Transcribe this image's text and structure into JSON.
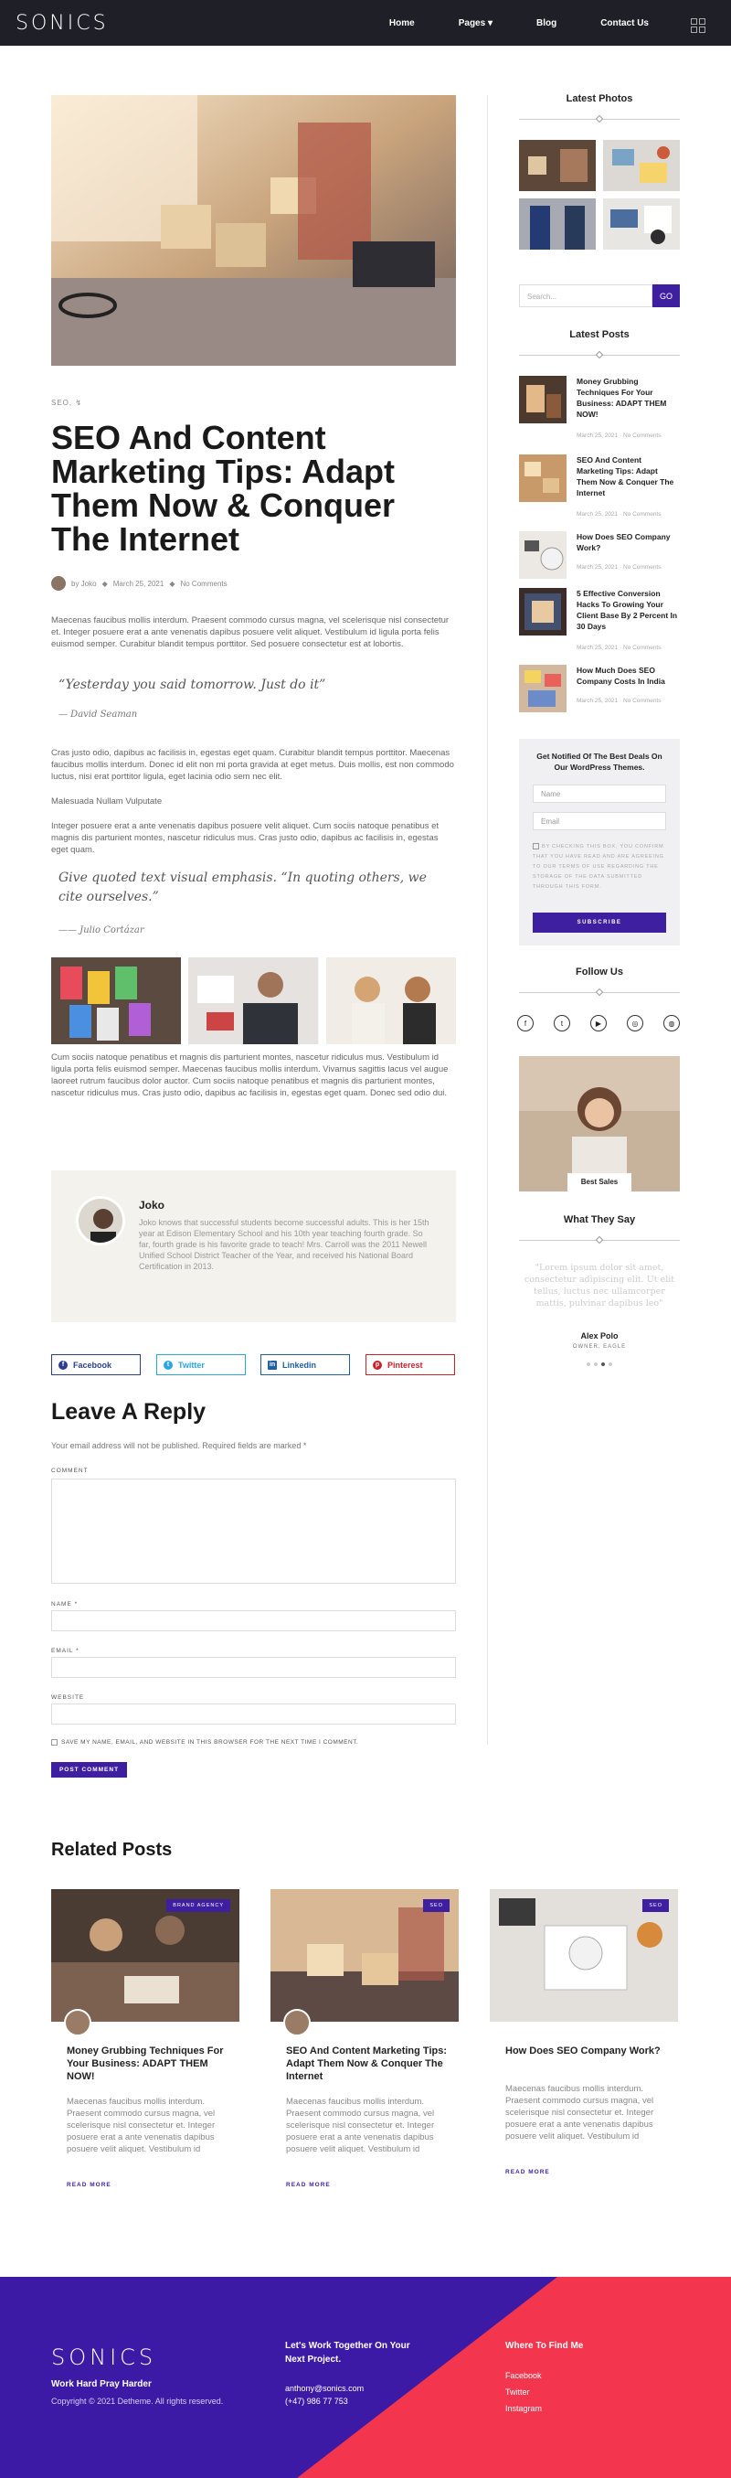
{
  "header": {
    "logo": "SONICS",
    "nav": [
      "Home",
      "Pages ▾",
      "Blog",
      "Contact Us"
    ]
  },
  "post": {
    "category": "SEO, ↯",
    "title": "SEO And Content Marketing Tips: Adapt Them Now & Conquer The Internet",
    "meta_author": "by Joko",
    "meta_date": "March 25, 2021",
    "meta_comments": "No Comments",
    "para1": "Maecenas faucibus mollis interdum. Praesent commodo cursus magna, vel scelerisque nisl consectetur et. Integer posuere erat a ante venenatis dapibus posuere velit aliquet. Vestibulum id ligula porta felis euismod semper. Curabitur blandit tempus porttitor. Sed posuere consectetur est at lobortis.",
    "quote1": "“Yesterday you said tomorrow. Just do it”",
    "cite1": "— David Seaman",
    "para2": "Cras justo odio, dapibus ac facilisis in, egestas eget quam. Curabitur blandit tempus porttitor. Maecenas faucibus mollis interdum. Donec id elit non mi porta gravida at eget metus. Duis mollis, est non commodo luctus, nisi erat porttitor ligula, eget lacinia odio sem nec elit.",
    "para3": "Malesuada Nullam Vulputate",
    "para4": "Integer posuere erat a ante venenatis dapibus posuere velit aliquet. Cum sociis natoque penatibus et magnis dis parturient montes, nascetur ridiculus mus. Cras justo odio, dapibus ac facilisis in, egestas eget quam.",
    "quote2": "Give quoted text visual emphasis. “In quoting others, we cite ourselves.”",
    "cite2": "—— Julio Cortázar",
    "para5": "Cum sociis natoque penatibus et magnis dis parturient montes, nascetur ridiculus mus. Vestibulum id ligula porta felis euismod semper. Maecenas faucibus mollis interdum. Vivamus sagittis lacus vel augue laoreet rutrum faucibus dolor auctor. Cum sociis natoque penatibus et magnis dis parturient montes, nascetur ridiculus mus. Cras justo odio, dapibus ac facilisis in, egestas eget quam. Donec sed odio dui."
  },
  "author": {
    "name": "Joko",
    "bio": "Joko knows that successful students become successful adults. This is her 15th year at Edison Elementary School and his 10th year teaching fourth grade. So far, fourth grade is his favorite grade to teach! Mrs. Carroll was the 2011 Newell Unified School District Teacher of the Year, and received his National Board Certification in 2013."
  },
  "share": {
    "facebook": "Facebook",
    "twitter": "Twitter",
    "linkedin": "Linkedin",
    "pinterest": "Pinterest"
  },
  "reply": {
    "title": "Leave A Reply",
    "note": "Your email address will not be published. Required fields are marked *",
    "comment_label": "COMMENT",
    "name_label": "NAME *",
    "email_label": "EMAIL *",
    "website_label": "WEBSITE",
    "save_label": "SAVE MY NAME, EMAIL, AND WEBSITE IN THIS BROWSER FOR THE NEXT TIME I COMMENT.",
    "submit": "POST COMMENT"
  },
  "sidebar": {
    "latest_photos": "Latest Photos",
    "search_placeholder": "Search...",
    "search_btn": "GO",
    "latest_posts": "Latest Posts",
    "posts": [
      {
        "title": "Money Grubbing Techniques For Your Business: ADAPT THEM NOW!",
        "date": "March 25, 2021",
        "comments": "No Comments"
      },
      {
        "title": "SEO And Content Marketing Tips: Adapt Them Now & Conquer The Internet",
        "date": "March 25, 2021",
        "comments": "No Comments"
      },
      {
        "title": "How Does SEO Company Work?",
        "date": "March 25, 2021",
        "comments": "No Comments"
      },
      {
        "title": "5 Effective Conversion Hacks To Growing Your Client Base By 2 Percent In 30 Days",
        "date": "March 25, 2021",
        "comments": "No Comments"
      },
      {
        "title": "How Much Does SEO Company Costs In India",
        "date": "March 25, 2021",
        "comments": "No Comments"
      }
    ],
    "newsletter_title": "Get Notified Of The Best Deals On Our WordPress Themes.",
    "name_ph": "Name",
    "email_ph": "Email",
    "consent": "BY CHECKING THIS BOX, YOU CONFIRM THAT YOU HAVE READ AND ARE AGREEING TO OUR TERMS OF USE REGARDING THE STORAGE OF THE DATA SUBMITTED THROUGH THIS FORM.",
    "subscribe": "SUBSCRIBE",
    "follow_us": "Follow Us",
    "best_sales": "Best Sales",
    "what_they_say": "What They Say",
    "testimonial": "\"Lorem ipsum dolor sit amet, consectetur adipiscing elit. Ut elit tellus, luctus nec ullamcorper mattis, pulvinar dapibus leo\"",
    "testimonial_name": "Alex Polo",
    "testimonial_role": "OWNER, EAGLE"
  },
  "related": {
    "title": "Related Posts",
    "items": [
      {
        "badge": "BRAND AGENCY",
        "title": "Money Grubbing Techniques For Your Business: ADAPT THEM NOW!",
        "excerpt": "Maecenas faucibus mollis interdum. Praesent commodo cursus magna, vel scelerisque nisl consectetur et. Integer posuere erat a ante venenatis dapibus posuere velit aliquet. Vestibulum id",
        "more": "READ MORE"
      },
      {
        "badge": "SEO",
        "title": "SEO And Content Marketing Tips: Adapt Them Now & Conquer The Internet",
        "excerpt": "Maecenas faucibus mollis interdum. Praesent commodo cursus magna, vel scelerisque nisl consectetur et. Integer posuere erat a ante venenatis dapibus posuere velit aliquet. Vestibulum id",
        "more": "READ MORE"
      },
      {
        "badge": "SEO",
        "title": "How Does SEO Company Work?",
        "excerpt": "Maecenas faucibus mollis interdum. Praesent commodo cursus magna, vel scelerisque nisl consectetur et. Integer posuere erat a ante venenatis dapibus posuere velit aliquet. Vestibulum id",
        "more": "READ MORE"
      }
    ]
  },
  "footer": {
    "logo": "SONICS",
    "slogan": "Work Hard Pray Harder",
    "copyright": "Copyright © 2021 Detheme. All rights reserved.",
    "work_title": "Let's Work Together On Your Next Project.",
    "email": "anthony@sonics.com",
    "phone": "(+47) 986 77 753",
    "find_title": "Where To Find Me",
    "links": [
      "Facebook",
      "Twitter",
      "Instagram"
    ]
  },
  "colors": {
    "accent": "#3e1fa0",
    "footer_red": "#f3364d",
    "header_bg": "#1f1f28"
  }
}
